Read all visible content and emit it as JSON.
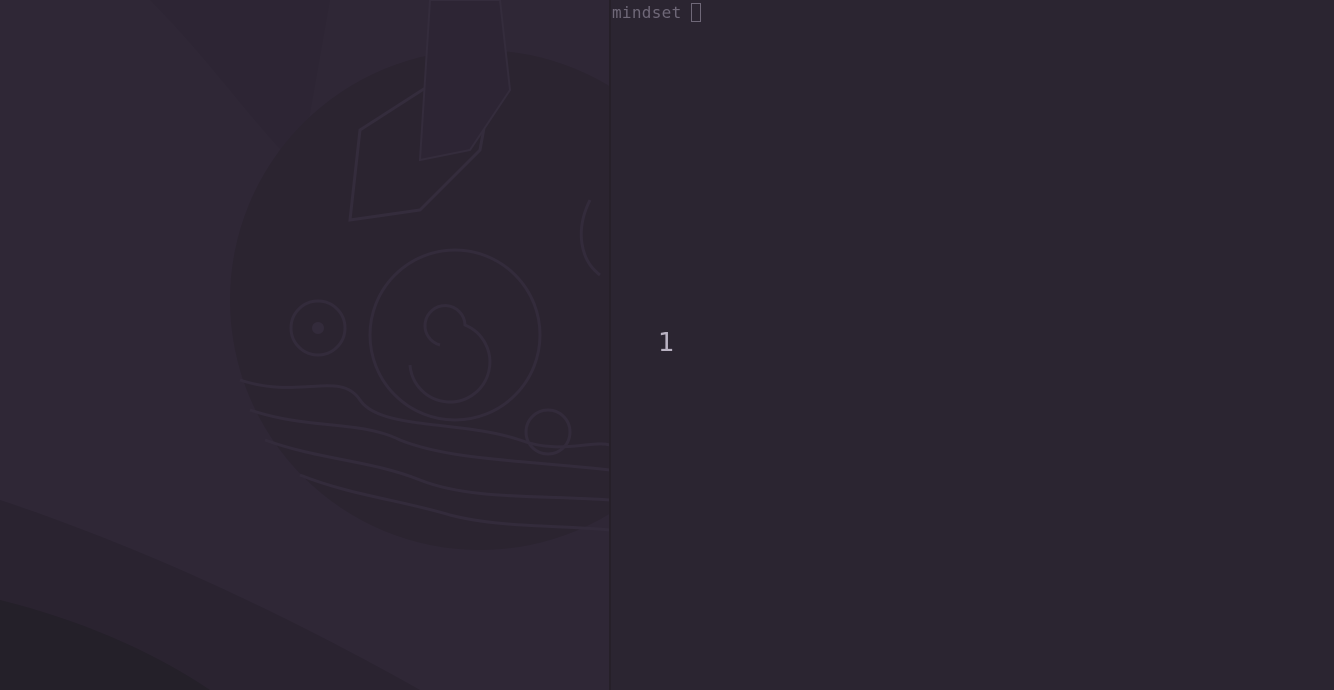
{
  "terminal": {
    "prompt_text": "mindset",
    "cursor_icon": "block-cursor-icon"
  },
  "main": {
    "counter_value": "1"
  },
  "colors": {
    "background": "#2a2430",
    "wallpaper": "#2e2635",
    "prompt_text": "#6f6878",
    "counter_text": "#b9b2c2"
  }
}
